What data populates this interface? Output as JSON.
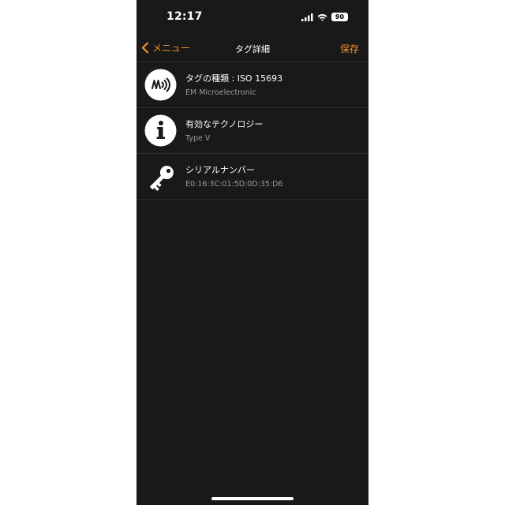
{
  "status_bar": {
    "time": "12:17",
    "battery": "90",
    "icons": [
      "signal-icon",
      "wifi-icon",
      "battery-icon"
    ]
  },
  "nav": {
    "back_label": "メニュー",
    "title": "タグ詳細",
    "save_label": "保存"
  },
  "rows": [
    {
      "icon": "nfc-icon",
      "title": "タグの種類 : ISO 15693",
      "subtitle": "EM Microelectronic"
    },
    {
      "icon": "info-icon",
      "title": "有効なテクノロジー",
      "subtitle": "Type V"
    },
    {
      "icon": "key-icon",
      "title": "シリアルナンバー",
      "subtitle": "E0:16:3C:01:5D:0D:35:D6"
    }
  ],
  "colors": {
    "background": "#191919",
    "accent": "#f0922c",
    "text": "#ffffff",
    "secondary_text": "#9a9a9a"
  }
}
